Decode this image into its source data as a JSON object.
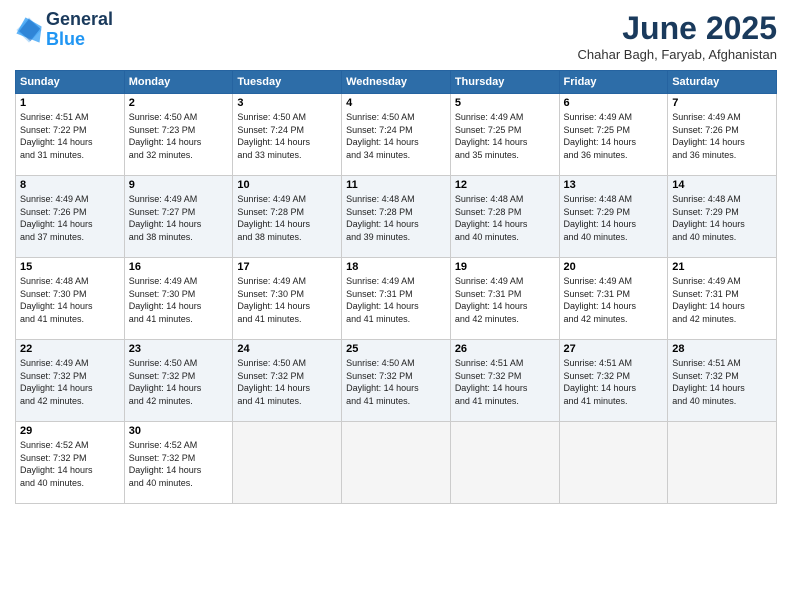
{
  "header": {
    "logo_line1": "General",
    "logo_line2": "Blue",
    "month": "June 2025",
    "location": "Chahar Bagh, Faryab, Afghanistan"
  },
  "weekdays": [
    "Sunday",
    "Monday",
    "Tuesday",
    "Wednesday",
    "Thursday",
    "Friday",
    "Saturday"
  ],
  "weeks": [
    [
      {
        "day": "1",
        "info": "Sunrise: 4:51 AM\nSunset: 7:22 PM\nDaylight: 14 hours\nand 31 minutes."
      },
      {
        "day": "2",
        "info": "Sunrise: 4:50 AM\nSunset: 7:23 PM\nDaylight: 14 hours\nand 32 minutes."
      },
      {
        "day": "3",
        "info": "Sunrise: 4:50 AM\nSunset: 7:24 PM\nDaylight: 14 hours\nand 33 minutes."
      },
      {
        "day": "4",
        "info": "Sunrise: 4:50 AM\nSunset: 7:24 PM\nDaylight: 14 hours\nand 34 minutes."
      },
      {
        "day": "5",
        "info": "Sunrise: 4:49 AM\nSunset: 7:25 PM\nDaylight: 14 hours\nand 35 minutes."
      },
      {
        "day": "6",
        "info": "Sunrise: 4:49 AM\nSunset: 7:25 PM\nDaylight: 14 hours\nand 36 minutes."
      },
      {
        "day": "7",
        "info": "Sunrise: 4:49 AM\nSunset: 7:26 PM\nDaylight: 14 hours\nand 36 minutes."
      }
    ],
    [
      {
        "day": "8",
        "info": "Sunrise: 4:49 AM\nSunset: 7:26 PM\nDaylight: 14 hours\nand 37 minutes."
      },
      {
        "day": "9",
        "info": "Sunrise: 4:49 AM\nSunset: 7:27 PM\nDaylight: 14 hours\nand 38 minutes."
      },
      {
        "day": "10",
        "info": "Sunrise: 4:49 AM\nSunset: 7:28 PM\nDaylight: 14 hours\nand 38 minutes."
      },
      {
        "day": "11",
        "info": "Sunrise: 4:48 AM\nSunset: 7:28 PM\nDaylight: 14 hours\nand 39 minutes."
      },
      {
        "day": "12",
        "info": "Sunrise: 4:48 AM\nSunset: 7:28 PM\nDaylight: 14 hours\nand 40 minutes."
      },
      {
        "day": "13",
        "info": "Sunrise: 4:48 AM\nSunset: 7:29 PM\nDaylight: 14 hours\nand 40 minutes."
      },
      {
        "day": "14",
        "info": "Sunrise: 4:48 AM\nSunset: 7:29 PM\nDaylight: 14 hours\nand 40 minutes."
      }
    ],
    [
      {
        "day": "15",
        "info": "Sunrise: 4:48 AM\nSunset: 7:30 PM\nDaylight: 14 hours\nand 41 minutes."
      },
      {
        "day": "16",
        "info": "Sunrise: 4:49 AM\nSunset: 7:30 PM\nDaylight: 14 hours\nand 41 minutes."
      },
      {
        "day": "17",
        "info": "Sunrise: 4:49 AM\nSunset: 7:30 PM\nDaylight: 14 hours\nand 41 minutes."
      },
      {
        "day": "18",
        "info": "Sunrise: 4:49 AM\nSunset: 7:31 PM\nDaylight: 14 hours\nand 41 minutes."
      },
      {
        "day": "19",
        "info": "Sunrise: 4:49 AM\nSunset: 7:31 PM\nDaylight: 14 hours\nand 42 minutes."
      },
      {
        "day": "20",
        "info": "Sunrise: 4:49 AM\nSunset: 7:31 PM\nDaylight: 14 hours\nand 42 minutes."
      },
      {
        "day": "21",
        "info": "Sunrise: 4:49 AM\nSunset: 7:31 PM\nDaylight: 14 hours\nand 42 minutes."
      }
    ],
    [
      {
        "day": "22",
        "info": "Sunrise: 4:49 AM\nSunset: 7:32 PM\nDaylight: 14 hours\nand 42 minutes."
      },
      {
        "day": "23",
        "info": "Sunrise: 4:50 AM\nSunset: 7:32 PM\nDaylight: 14 hours\nand 42 minutes."
      },
      {
        "day": "24",
        "info": "Sunrise: 4:50 AM\nSunset: 7:32 PM\nDaylight: 14 hours\nand 41 minutes."
      },
      {
        "day": "25",
        "info": "Sunrise: 4:50 AM\nSunset: 7:32 PM\nDaylight: 14 hours\nand 41 minutes."
      },
      {
        "day": "26",
        "info": "Sunrise: 4:51 AM\nSunset: 7:32 PM\nDaylight: 14 hours\nand 41 minutes."
      },
      {
        "day": "27",
        "info": "Sunrise: 4:51 AM\nSunset: 7:32 PM\nDaylight: 14 hours\nand 41 minutes."
      },
      {
        "day": "28",
        "info": "Sunrise: 4:51 AM\nSunset: 7:32 PM\nDaylight: 14 hours\nand 40 minutes."
      }
    ],
    [
      {
        "day": "29",
        "info": "Sunrise: 4:52 AM\nSunset: 7:32 PM\nDaylight: 14 hours\nand 40 minutes."
      },
      {
        "day": "30",
        "info": "Sunrise: 4:52 AM\nSunset: 7:32 PM\nDaylight: 14 hours\nand 40 minutes."
      },
      {
        "day": "",
        "info": ""
      },
      {
        "day": "",
        "info": ""
      },
      {
        "day": "",
        "info": ""
      },
      {
        "day": "",
        "info": ""
      },
      {
        "day": "",
        "info": ""
      }
    ]
  ]
}
